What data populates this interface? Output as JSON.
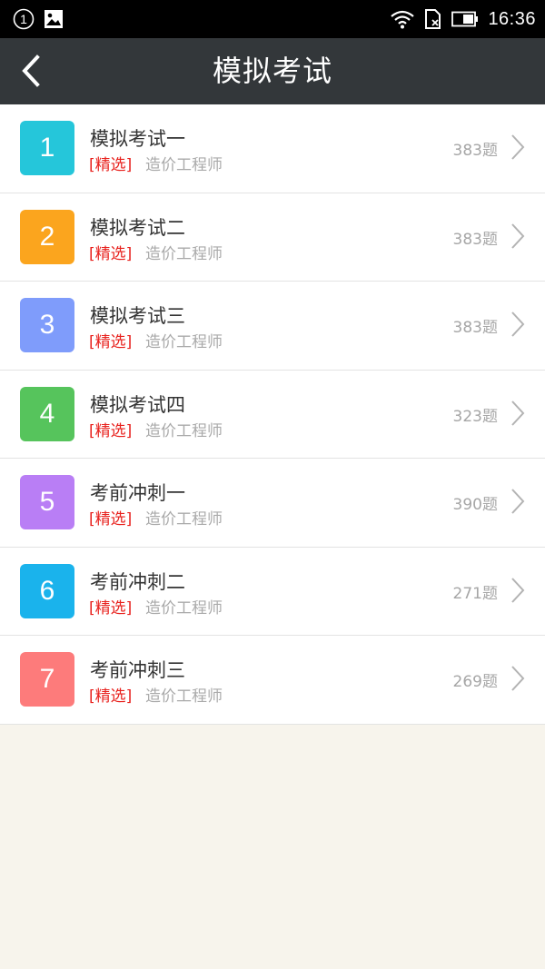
{
  "status_bar": {
    "notification_count": "1",
    "time": "16:36",
    "icons": [
      "notification-circle-icon",
      "image-icon",
      "wifi-icon",
      "no-sim-icon",
      "battery-icon"
    ]
  },
  "toolbar": {
    "title": "模拟考试",
    "back_icon": "back-arrow-icon"
  },
  "colors": {
    "toolbar_bg": "#33373a",
    "tag_red": "#e8211d",
    "page_bg": "#f7f4ec"
  },
  "exams": [
    {
      "number": "1",
      "title": "模拟考试一",
      "tag": "[精选]",
      "subtitle": "造价工程师",
      "count": "383题",
      "color": "#25c6da"
    },
    {
      "number": "2",
      "title": "模拟考试二",
      "tag": "[精选]",
      "subtitle": "造价工程师",
      "count": "383题",
      "color": "#fba51e"
    },
    {
      "number": "3",
      "title": "模拟考试三",
      "tag": "[精选]",
      "subtitle": "造价工程师",
      "count": "383题",
      "color": "#7f9cfb"
    },
    {
      "number": "4",
      "title": "模拟考试四",
      "tag": "[精选]",
      "subtitle": "造价工程师",
      "count": "323题",
      "color": "#56c45c"
    },
    {
      "number": "5",
      "title": "考前冲刺一",
      "tag": "[精选]",
      "subtitle": "造价工程师",
      "count": "390题",
      "color": "#b97ef5"
    },
    {
      "number": "6",
      "title": "考前冲刺二",
      "tag": "[精选]",
      "subtitle": "造价工程师",
      "count": "271题",
      "color": "#1ab3ec"
    },
    {
      "number": "7",
      "title": "考前冲刺三",
      "tag": "[精选]",
      "subtitle": "造价工程师",
      "count": "269题",
      "color": "#fd7b7b"
    }
  ]
}
